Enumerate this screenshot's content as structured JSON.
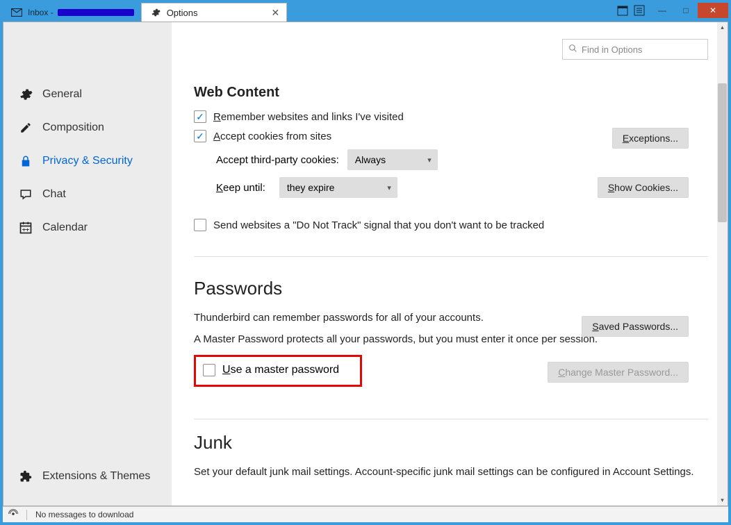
{
  "tabs": {
    "inactive_label": "Inbox - ",
    "active_label": "Options"
  },
  "sidebar": {
    "items": [
      {
        "label": "General"
      },
      {
        "label": "Composition"
      },
      {
        "label": "Privacy & Security"
      },
      {
        "label": "Chat"
      },
      {
        "label": "Calendar"
      }
    ],
    "footer_label": "Extensions & Themes"
  },
  "search": {
    "placeholder": "Find in Options"
  },
  "web_content": {
    "title": "Web Content",
    "remember_label": "Remember websites and links I've visited",
    "remember_checked": true,
    "accept_cookies_label": "Accept cookies from sites",
    "accept_cookies_checked": true,
    "exceptions_btn": "Exceptions...",
    "accept_third_party_label": "Accept third-party cookies:",
    "accept_third_party_value": "Always",
    "keep_until_label": "Keep until:",
    "keep_until_value": "they expire",
    "show_cookies_btn": "Show Cookies...",
    "dnt_label": "Send websites a \"Do Not Track\" signal that you don't want to be tracked",
    "dnt_checked": false
  },
  "passwords": {
    "title": "Passwords",
    "intro": "Thunderbird can remember passwords for all of your accounts.",
    "saved_btn": "Saved Passwords...",
    "master_intro": "A Master Password protects all your passwords, but you must enter it once per session.",
    "use_master_label": "Use a master password",
    "use_master_checked": false,
    "change_master_btn": "Change Master Password..."
  },
  "junk": {
    "title": "Junk",
    "intro": "Set your default junk mail settings. Account-specific junk mail settings can be configured in Account Settings."
  },
  "status": {
    "message": "No messages to download"
  }
}
